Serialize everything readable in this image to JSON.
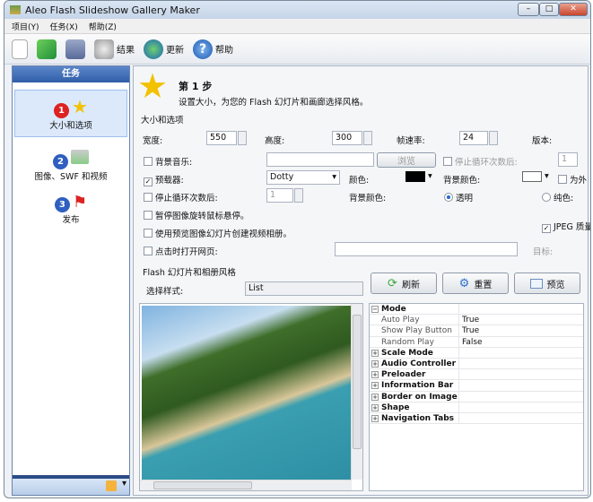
{
  "window": {
    "title": "Aleo Flash Slideshow Gallery Maker",
    "minimize": "–",
    "maximize": "□",
    "close": "✕"
  },
  "menu": [
    "项目(Y)",
    "任务(X)",
    "帮助(Z)"
  ],
  "toolbar": {
    "results": "结果",
    "update": "更新",
    "help": "帮助"
  },
  "sidebar": {
    "title": "任务",
    "tasks": [
      {
        "num": "1",
        "label": "大小和选项"
      },
      {
        "num": "2",
        "label": "图像、SWF 和视频"
      },
      {
        "num": "3",
        "label": "发布"
      }
    ]
  },
  "step": {
    "title": "第 1 步",
    "subtitle": "设置大小，为您的 Flash 幻灯片和画廊选择风格。"
  },
  "size": {
    "section": "大小和选项",
    "width_label": "宽度:",
    "width": "550",
    "height_label": "高度:",
    "height": "300",
    "fps_label": "帧速率:",
    "fps": "24",
    "version_label": "版本:",
    "bg_music": "背景音乐:",
    "browse": "浏览",
    "stop_loop_after": "停止循环次数后:",
    "loop_count": "1",
    "preloader": "预载器:",
    "preloader_value": "Dotty",
    "color_label": "颜色:",
    "bg_color_label": "背景颜色:",
    "outer": "为外",
    "stop_loop_after2": "停止循环次数后:",
    "loop_count2": "1",
    "bg_color_label2": "背景颜色:",
    "transparent": "透明",
    "solid": "纯色:",
    "pause_hover": "暂停图像旋转鼠标悬停。",
    "use_preview": "使用预览图像幻灯片创建视频相册。",
    "jpeg": "JPEG 质量",
    "open_url": "点击时打开网页:",
    "target": "目标:",
    "colors": {
      "preloader_color": "#000000",
      "bg_color": "#ffffff"
    }
  },
  "style": {
    "section": "Flash 幻灯片和相册风格",
    "select_label": "选择样式:",
    "select_value": "List",
    "refresh": "刷新",
    "reset": "重置",
    "preview": "预览"
  },
  "properties": [
    {
      "name": "Mode",
      "category": true,
      "expanded": true
    },
    {
      "name": "Auto Play",
      "value": "True"
    },
    {
      "name": "Show Play Button",
      "value": "True"
    },
    {
      "name": "Random Play",
      "value": "False"
    },
    {
      "name": "Scale Mode",
      "category": true
    },
    {
      "name": "Audio Controller",
      "category": true
    },
    {
      "name": "Preloader",
      "category": true
    },
    {
      "name": "Information Bar",
      "category": true
    },
    {
      "name": "Border on Image",
      "category": true
    },
    {
      "name": "Shape",
      "category": true
    },
    {
      "name": "Navigation Tabs",
      "category": true
    }
  ]
}
